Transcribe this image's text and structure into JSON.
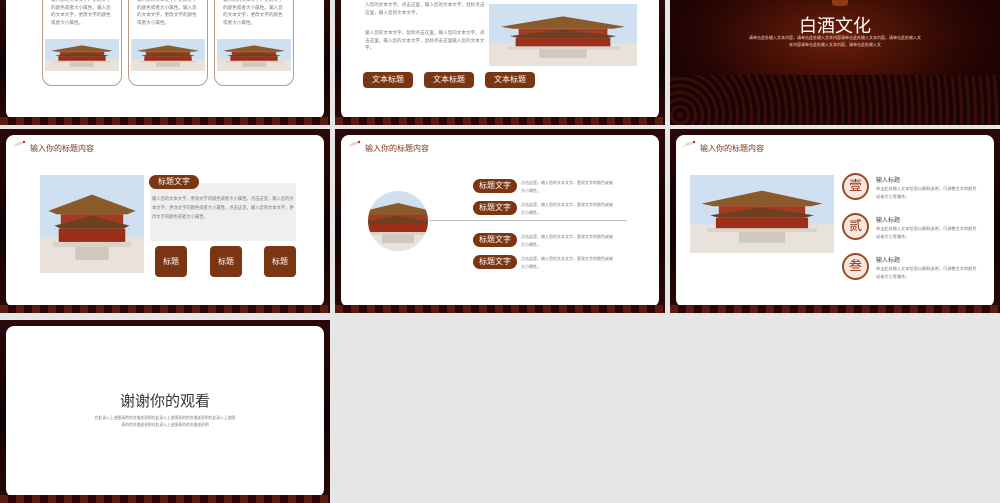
{
  "colors": {
    "accent": "#7a3512",
    "dark_bg": "#1a0404",
    "title_text": "#7a3515"
  },
  "slide1": {
    "cards": [
      {
        "text": "输入您的文本文字，更改文字的颜色或者大小属性。输入您的文本文字，更改文字的颜色或者大小属性。"
      },
      {
        "text": "输入您的文本文字，更改文字的颜色或者大小属性。输入您的文本文字，更改文字的颜色或者大小属性。"
      },
      {
        "text": "输入您的文本文字，更改文字的颜色或者大小属性。输入您的文本文字，更改文字的颜色或者大小属性。"
      }
    ]
  },
  "slide2": {
    "para1": "入您的文本文字。点击这里，输入您的文本文字，鼠标点击这里，输入您的文本文字。",
    "para2": "输入您的文本文字，鼠标点击这里，输入您的文本文字。点击这里，输入您的文本文字，鼠标点击这里输入您的文本文字。",
    "buttons": [
      "文本标题",
      "文本标题",
      "文本标题"
    ]
  },
  "slide3": {
    "title": "白酒文化",
    "line1": "请单击此处输入文本内容，请单击此处输入文本内容请单击此处输入文本内容，请单击此处输入文",
    "line2": "本内容请单击此处输入文本内容，请单击此处输入文"
  },
  "slide4": {
    "header": "输入你的标题内容",
    "pill": "标题文字",
    "body": "输入您的文本文字，更改文字的颜色或者大小属性。点击这里，输入您的文本文字，更改文字的颜色或者大小属性。点击这里，输入您的文本文字，更改文字的颜色或者大小属性。",
    "buttons": [
      "标题",
      "标题",
      "标题"
    ]
  },
  "slide5": {
    "header": "输入你的标题内容",
    "items": [
      {
        "label": "标题文字",
        "text": "点击这里，输入您的文本文字，更改文字的颜色或者大小属性。"
      },
      {
        "label": "标题文字",
        "text": "点击这里，输入您的文本文字，更改文字的颜色或者大小属性。"
      },
      {
        "label": "标题文字",
        "text": "点击这里，输入您的文本文字，更改文字的颜色或者大小属性。"
      },
      {
        "label": "标题文字",
        "text": "点击这里，输入您的文本文字，更改文字的颜色或者大小属性。"
      }
    ]
  },
  "slide6": {
    "header": "输入你的标题内容",
    "items": [
      {
        "seal": "壹",
        "title": "输入标题",
        "text": "单击此处输入文本信息以解释说明，可调整文字的颜色或者大小等属性。"
      },
      {
        "seal": "贰",
        "title": "输入标题",
        "text": "单击此处输入文本信息以解释说明，可调整文字的颜色或者大小等属性。"
      },
      {
        "seal": "叁",
        "title": "输入标题",
        "text": "单击此处输入文本信息以解释说明，可调整文字的颜色或者大小等属性。"
      }
    ]
  },
  "slide7": {
    "title": "谢谢你的观看",
    "line1": "在此录入上述图表的综合描述说明在此录入上述图表的综合描述说明在此录入上述图",
    "line2": "表的综合描述说明在此录入上述图表的综合描述说明"
  }
}
